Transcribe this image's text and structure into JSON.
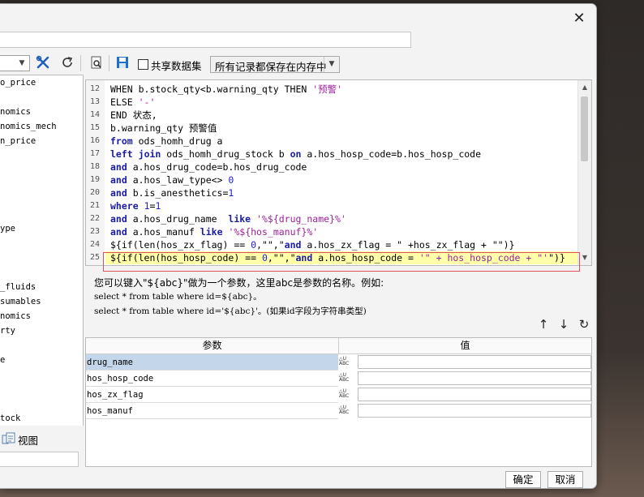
{
  "dialog": {
    "close_glyph": "✕",
    "name_value": ""
  },
  "toolbar": {
    "left_combo_value": "",
    "share_label": "共享数据集",
    "share_checked": false,
    "save_mode_value": "所有记录都保存在内存中",
    "icons": [
      "tools-icon",
      "refresh-icon",
      "preview-icon",
      "save-icon"
    ]
  },
  "left_panel": {
    "items": [
      {
        "label": "o_price"
      },
      {
        "label": "nomics"
      },
      {
        "label": "nomics_mech"
      },
      {
        "label": "n_price"
      },
      {
        "label": "ype"
      },
      {
        "label": "_fluids"
      },
      {
        "label": "sumables"
      },
      {
        "label": "nomics"
      },
      {
        "label": "rty"
      },
      {
        "label": "e"
      },
      {
        "label": "tock"
      }
    ],
    "view_label": "视图",
    "filter_value": ""
  },
  "editor": {
    "lines": [
      {
        "n": "12",
        "t": "WHEN b.stock_qty<b.warning_qty THEN '预警'"
      },
      {
        "n": "13",
        "t": "ELSE '-'"
      },
      {
        "n": "14",
        "t": "END 状态,"
      },
      {
        "n": "15",
        "t": "b.warning_qty 预警值"
      },
      {
        "n": "16",
        "t": "from ods_homh_drug a"
      },
      {
        "n": "17",
        "t": "left join ods_homh_drug_stock b on a.hos_hosp_code=b.hos_hosp_code"
      },
      {
        "n": "18",
        "t": "and a.hos_drug_code=b.hos_drug_code"
      },
      {
        "n": "19",
        "t": "and a.hos_law_type<> 0"
      },
      {
        "n": "20",
        "t": "and b.is_anesthetics=1"
      },
      {
        "n": "21",
        "t": "where 1=1"
      },
      {
        "n": "22",
        "t": "and a.hos_drug_name  like '%${drug_name}%'"
      },
      {
        "n": "23",
        "t": "and a.hos_manuf like '%${hos_manuf}%'"
      },
      {
        "n": "24",
        "t": "${if(len(hos_zx_flag) == 0,\"\",\"and a.hos_zx_flag = \" +hos_zx_flag + \"\")}"
      },
      {
        "n": "25",
        "t": "${if(len(hos_hosp_code) == 0,\"\",\"and a.hos_hosp_code = '\" + hos_hosp_code + \"'\")}"
      }
    ]
  },
  "hint": {
    "line1": "您可以键入\"${abc}\"做为一个参数，这里abc是参数的名称。例如:",
    "line2": "select * from table where id=${abc}。",
    "line3": "select * from table where id='${abc}'。(如果id字段为字符串类型)"
  },
  "params": {
    "col_name": "参数",
    "col_value": "值",
    "type_top": "△U",
    "type_bottom": "ABC",
    "rows": [
      {
        "name": "drug_name",
        "value": "",
        "selected": true
      },
      {
        "name": "hos_hosp_code",
        "value": "",
        "selected": false
      },
      {
        "name": "hos_zx_flag",
        "value": "",
        "selected": false
      },
      {
        "name": "hos_manuf",
        "value": "",
        "selected": false
      }
    ]
  },
  "buttons": {
    "ok": "确定",
    "cancel": "取消"
  },
  "colors": {
    "keyword": "#1a1aa6",
    "string": "#a0209b",
    "highlight": "#ffffaa",
    "selected_row": "#c4d7ea",
    "annotation_box": "#e0505a"
  }
}
